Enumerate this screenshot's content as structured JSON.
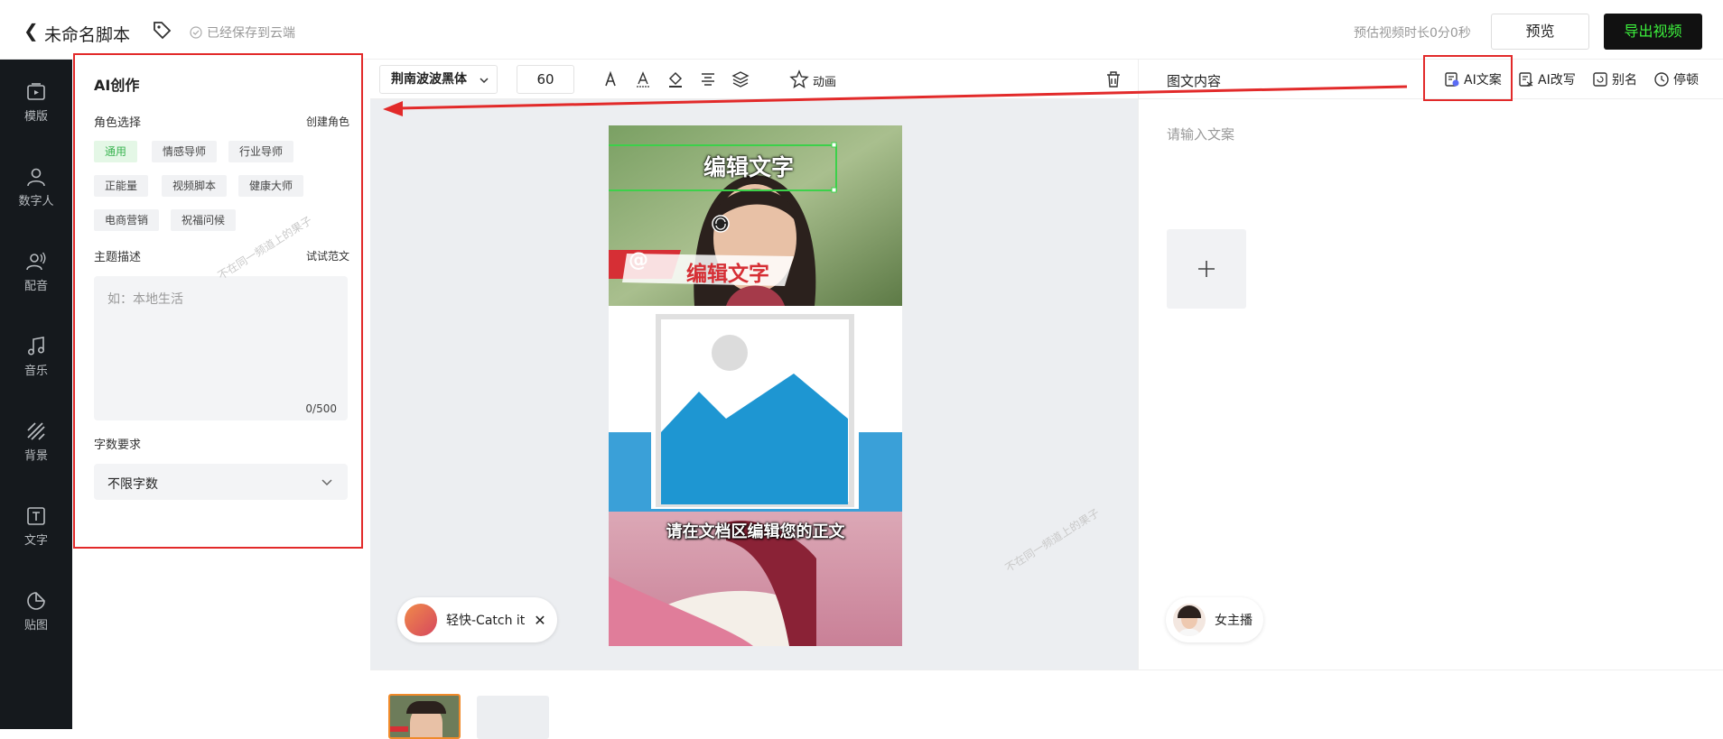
{
  "header": {
    "title": "未命名脚本",
    "saved_status": "已经保存到云端",
    "estimated_duration": "预估视频时长0分0秒",
    "preview_label": "预览",
    "export_label": "导出视频"
  },
  "sidebar": {
    "items": [
      {
        "label": "模版",
        "icon": "template-icon"
      },
      {
        "label": "数字人",
        "icon": "digital-human-icon"
      },
      {
        "label": "配音",
        "icon": "voice-icon"
      },
      {
        "label": "音乐",
        "icon": "music-icon"
      },
      {
        "label": "背景",
        "icon": "background-icon"
      },
      {
        "label": "文字",
        "icon": "text-icon"
      },
      {
        "label": "贴图",
        "icon": "sticker-icon"
      }
    ]
  },
  "ai_panel": {
    "title": "AI创作",
    "role_label": "角色选择",
    "create_role": "创建角色",
    "roles": [
      "通用",
      "情感导师",
      "行业导师",
      "正能量",
      "视频脚本",
      "健康大师",
      "电商营销",
      "祝福问候"
    ],
    "selected_role": "通用",
    "topic_label": "主题描述",
    "try_example": "试试范文",
    "topic_placeholder": "如：本地生活",
    "char_count": "0/500",
    "word_req_label": "字数要求",
    "word_req_value": "不限字数"
  },
  "toolbar": {
    "font": "荆南波波黑体",
    "font_size": "60",
    "animation_label": "动画"
  },
  "canvas": {
    "title_text": "编辑文字",
    "banner_text": "编辑文字",
    "at_symbol": "@",
    "subtitle": "请在文档区编辑您的正文",
    "music_label": "轻快-Catch it",
    "watermark": "不在同一频道上的果子"
  },
  "right_panel": {
    "title": "图文内容",
    "ai_copy": "AI文案",
    "ai_rewrite": "AI改写",
    "alias": "别名",
    "pause": "停顿",
    "placeholder": "请输入文案",
    "anchor_label": "女主播"
  },
  "colors": {
    "accent_green": "#3cf03c",
    "highlight_red": "#e22a2a",
    "chip_active": "#3cb553"
  }
}
